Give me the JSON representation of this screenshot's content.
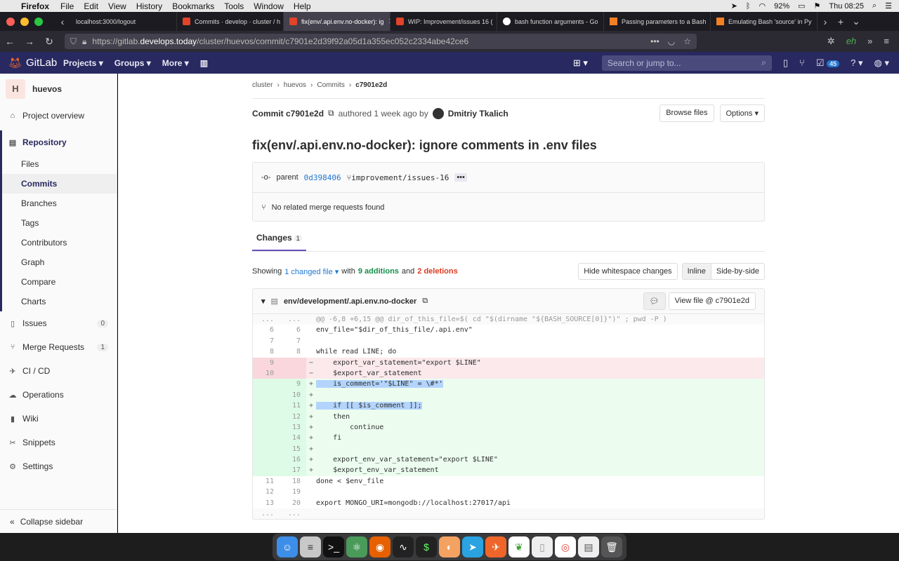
{
  "menubar": {
    "app": "Firefox",
    "items": [
      "File",
      "Edit",
      "View",
      "History",
      "Bookmarks",
      "Tools",
      "Window",
      "Help"
    ],
    "battery": "92%",
    "clock": "Thu 08:25"
  },
  "tabs": [
    {
      "label": "localhost:3000/logout"
    },
    {
      "label": "Commits · develop · cluster / h"
    },
    {
      "label": "fix(env/.api.env.no-docker): ig"
    },
    {
      "label": "WIP: Improvement/issues 16 ("
    },
    {
      "label": "bash function arguments - Go"
    },
    {
      "label": "Passing parameters to a Bash"
    },
    {
      "label": "Emulating Bash 'source' in Py"
    }
  ],
  "url": {
    "prefix": "https://gitlab.",
    "domain": "develops.today",
    "path": "/cluster/huevos/commit/c7901e2d39f92a05d1a355ec052c2334abe42ce6"
  },
  "gitlab": {
    "brand": "GitLab",
    "nav": [
      "Projects",
      "Groups",
      "More"
    ],
    "search_placeholder": "Search or jump to...",
    "todo_count": "45"
  },
  "sidebar": {
    "project_initial": "H",
    "project_name": "huevos",
    "overview": "Project overview",
    "repository": "Repository",
    "sub": [
      "Files",
      "Commits",
      "Branches",
      "Tags",
      "Contributors",
      "Graph",
      "Compare",
      "Charts"
    ],
    "issues": "Issues",
    "issues_count": "0",
    "mr": "Merge Requests",
    "mr_count": "1",
    "cicd": "CI / CD",
    "operations": "Operations",
    "wiki": "Wiki",
    "snippets": "Snippets",
    "settings": "Settings",
    "collapse": "Collapse sidebar"
  },
  "commit": {
    "breadcrumb": [
      "cluster",
      "huevos",
      "Commits",
      "c7901e2d"
    ],
    "label": "Commit c7901e2d",
    "authored": "authored 1 week ago by",
    "author": "Dmitriy Tkalich",
    "browse": "Browse files",
    "options": "Options",
    "title": "fix(env/.api.env.no-docker): ignore comments in .env files",
    "parent_label": "parent",
    "parent_sha": "0d398406",
    "branch": "improvement/issues-16",
    "no_mr": "No related merge requests found",
    "changes_tab": "Changes",
    "changes_count": "1",
    "showing": "Showing",
    "changed_files": "1 changed file",
    "with": "with",
    "additions": "9 additions",
    "and": "and",
    "deletions": "2 deletions",
    "hide_ws": "Hide whitespace changes",
    "inline": "Inline",
    "side": "Side-by-side"
  },
  "diff": {
    "file": "env/development/.api.env.no-docker",
    "view_file": "View file @ c7901e2d",
    "lines": [
      {
        "t": "match",
        "o": "...",
        "n": "...",
        "s": "",
        "c": "@@ -6,8 +6,15 @@ dir_of_this_file=$( cd \"$(dirname \"${BASH_SOURCE[0]}\")\" ; pwd -P )"
      },
      {
        "t": "ctx",
        "o": "6",
        "n": "6",
        "s": "",
        "c": "env_file=\"$dir_of_this_file/.api.env\""
      },
      {
        "t": "ctx",
        "o": "7",
        "n": "7",
        "s": "",
        "c": ""
      },
      {
        "t": "ctx",
        "o": "8",
        "n": "8",
        "s": "",
        "c": "while read LINE; do"
      },
      {
        "t": "old",
        "o": "9",
        "n": "",
        "s": "−",
        "c": "    export_var_statement=\"export $LINE\""
      },
      {
        "t": "old",
        "o": "10",
        "n": "",
        "s": "−",
        "c": "    $export_var_statement"
      },
      {
        "t": "new",
        "o": "",
        "n": "9",
        "s": "+",
        "c": "    is_comment='\"$LINE\" = \\#*'",
        "hl": true
      },
      {
        "t": "new",
        "o": "",
        "n": "10",
        "s": "+",
        "c": ""
      },
      {
        "t": "new",
        "o": "",
        "n": "11",
        "s": "+",
        "c": "    if [[ $is_comment ]];",
        "hl": true
      },
      {
        "t": "new",
        "o": "",
        "n": "12",
        "s": "+",
        "c": "    then"
      },
      {
        "t": "new",
        "o": "",
        "n": "13",
        "s": "+",
        "c": "        continue"
      },
      {
        "t": "new",
        "o": "",
        "n": "14",
        "s": "+",
        "c": "    fi"
      },
      {
        "t": "new",
        "o": "",
        "n": "15",
        "s": "+",
        "c": ""
      },
      {
        "t": "new",
        "o": "",
        "n": "16",
        "s": "+",
        "c": "    export_env_var_statement=\"export $LINE\""
      },
      {
        "t": "new",
        "o": "",
        "n": "17",
        "s": "+",
        "c": "    $export_env_var_statement"
      },
      {
        "t": "ctx",
        "o": "11",
        "n": "18",
        "s": "",
        "c": "done < $env_file"
      },
      {
        "t": "ctx",
        "o": "12",
        "n": "19",
        "s": "",
        "c": ""
      },
      {
        "t": "ctx",
        "o": "13",
        "n": "20",
        "s": "",
        "c": "export MONGO_URI=mongodb://localhost:27017/api"
      },
      {
        "t": "match",
        "o": "...",
        "n": "...",
        "s": "",
        "c": ""
      }
    ]
  }
}
